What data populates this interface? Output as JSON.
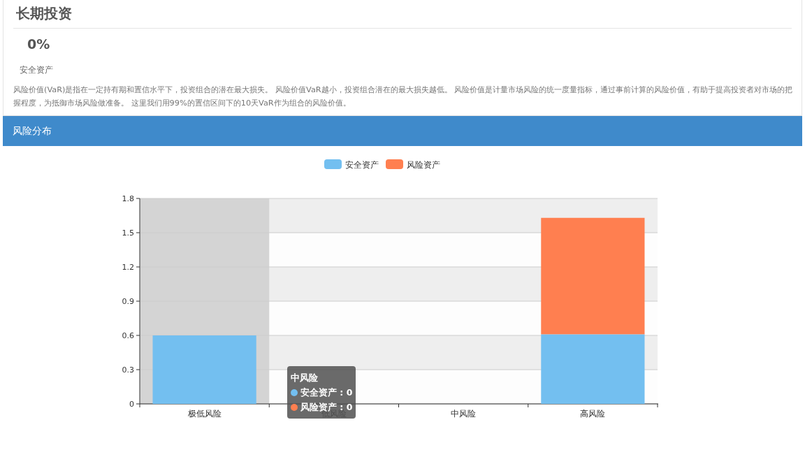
{
  "title": "长期投资",
  "stat": {
    "value": "0%",
    "label": "安全资产"
  },
  "description": "风险价值(VaR)是指在一定持有期和置信水平下，投资组合的潜在最大损失。 风险价值VaR越小，投资组合潜在的最大损失越低。 风险价值是计量市场风险的统一度量指标，通过事前计算的风险价值，有助于提高投资者对市场的把握程度，为抵御市场风险做准备。 这里我们用99%的置信区间下的10天VaR作为组合的风险价值。",
  "panel": {
    "title": "风险分布",
    "chart_data": {
      "type": "bar",
      "stacked": true,
      "categories": [
        "极低风险",
        "低风险",
        "中风险",
        "高风险"
      ],
      "series": [
        {
          "name": "安全资产",
          "color": "#73bff0",
          "values": [
            0.6,
            0,
            0,
            0.61
          ]
        },
        {
          "name": "风险资产",
          "color": "#ff7f50",
          "values": [
            0,
            0,
            0,
            1.02
          ]
        }
      ],
      "ylim": [
        0,
        1.8
      ],
      "yticks": [
        0,
        0.3,
        0.6,
        0.9,
        1.2,
        1.5,
        1.8
      ],
      "grid": true,
      "legend": true,
      "bands": [
        {
          "axis": "x",
          "from": "极低风险",
          "to": "极低风险",
          "color": "#d4d4d4"
        }
      ]
    },
    "tooltip": {
      "title": "中风险",
      "items": [
        {
          "label": "安全资产 : 0",
          "color": "#73bff0"
        },
        {
          "label": "风险资产 : 0",
          "color": "#ff7f50"
        }
      ]
    }
  }
}
